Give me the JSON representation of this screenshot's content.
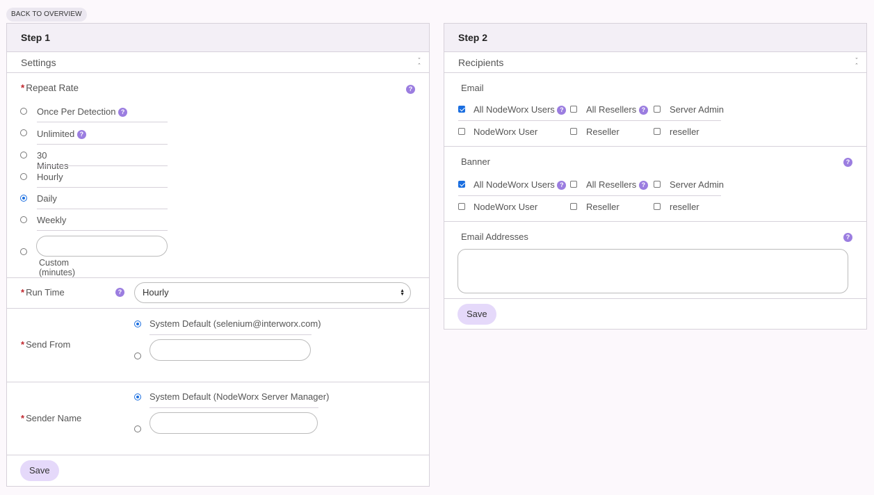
{
  "back_label": "BACK TO OVERVIEW",
  "step1": {
    "title": "Step 1",
    "section": "Settings",
    "repeat_rate": {
      "label": "Repeat Rate",
      "options": [
        "Once Per Detection",
        "Unlimited",
        "30 Minutes",
        "Hourly",
        "Daily",
        "Weekly"
      ],
      "selected": "Daily",
      "custom_label": "Custom (minutes)",
      "custom_value": ""
    },
    "run_time": {
      "label": "Run Time",
      "value": "Hourly"
    },
    "send_from": {
      "label": "Send From",
      "default_option": "System Default (selenium@interworx.com)",
      "custom_value": ""
    },
    "sender_name": {
      "label": "Sender Name",
      "default_option": "System Default (NodeWorx Server Manager)",
      "custom_value": ""
    },
    "save_label": "Save"
  },
  "step2": {
    "title": "Step 2",
    "section": "Recipients",
    "email": {
      "label": "Email",
      "options": [
        "All NodeWorx Users",
        "All Resellers",
        "Server Admin",
        "NodeWorx User",
        "Reseller",
        "reseller"
      ],
      "checked": [
        "All NodeWorx Users"
      ]
    },
    "banner": {
      "label": "Banner",
      "options": [
        "All NodeWorx Users",
        "All Resellers",
        "Server Admin",
        "NodeWorx User",
        "Reseller",
        "reseller"
      ],
      "checked": [
        "All NodeWorx Users"
      ]
    },
    "email_addresses": {
      "label": "Email Addresses",
      "value": ""
    },
    "save_label": "Save"
  },
  "help_glyph": "?"
}
